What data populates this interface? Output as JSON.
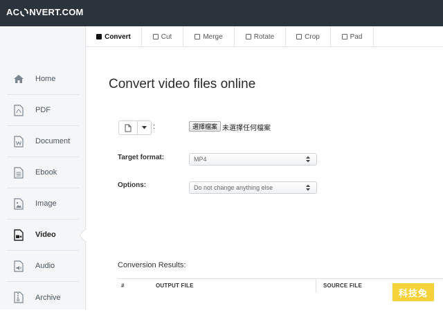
{
  "brand": {
    "part1": "AC",
    "part2": "NVERT.COM"
  },
  "tabs": [
    {
      "label": "Convert",
      "active": true
    },
    {
      "label": "Cut",
      "active": false
    },
    {
      "label": "Merge",
      "active": false
    },
    {
      "label": "Rotate",
      "active": false
    },
    {
      "label": "Crop",
      "active": false
    },
    {
      "label": "Pad",
      "active": false
    }
  ],
  "sidebar": {
    "items": [
      {
        "label": "Home",
        "icon": "home-icon"
      },
      {
        "label": "PDF",
        "icon": "pdf-icon"
      },
      {
        "label": "Document",
        "icon": "document-icon"
      },
      {
        "label": "Ebook",
        "icon": "ebook-icon"
      },
      {
        "label": "Image",
        "icon": "image-icon"
      },
      {
        "label": "Video",
        "icon": "video-icon",
        "active": true
      },
      {
        "label": "Audio",
        "icon": "audio-icon"
      },
      {
        "label": "Archive",
        "icon": "archive-icon"
      }
    ]
  },
  "main": {
    "title": "Convert video files online",
    "file": {
      "colon": ":",
      "choose_label": "選擇檔案",
      "no_file_label": "未選擇任何檔案"
    },
    "target_format": {
      "label": "Target format:",
      "value": "MP4"
    },
    "options": {
      "label": "Options:",
      "value": "Do not change anything else"
    },
    "results": {
      "label": "Conversion Results:",
      "columns": [
        "#",
        "OUTPUT FILE",
        "SOURCE FILE"
      ]
    }
  },
  "watermark": "科技兔",
  "colors": {
    "header": "#2b333d",
    "sidebar": "#f5f6f7",
    "watermark": "#f5d23a"
  }
}
